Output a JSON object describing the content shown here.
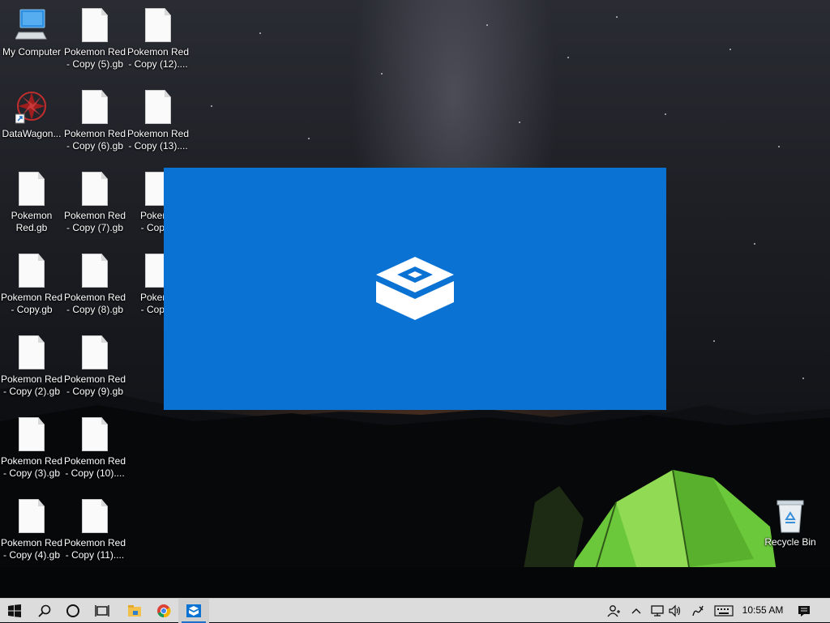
{
  "desktop": {
    "icons": [
      {
        "label": "My Computer"
      },
      {
        "label": "DataWagon..."
      },
      {
        "label": "Pokemon\nRed.gb"
      },
      {
        "label": "Pokemon Red\n- Copy.gb"
      },
      {
        "label": "Pokemon Red\n- Copy (2).gb"
      },
      {
        "label": "Pokemon Red\n- Copy (3).gb"
      },
      {
        "label": "Pokemon Red\n- Copy (4).gb"
      },
      {
        "label": "Pokemon Red\n- Copy (5).gb"
      },
      {
        "label": "Pokemon Red\n- Copy (6).gb"
      },
      {
        "label": "Pokemon Red\n- Copy (7).gb"
      },
      {
        "label": "Pokemon Red\n- Copy (8).gb"
      },
      {
        "label": "Pokemon Red\n- Copy (9).gb"
      },
      {
        "label": "Pokemon Red\n- Copy (10)...."
      },
      {
        "label": "Pokemon Red\n- Copy (11)...."
      },
      {
        "label": "Pokemon Red\n- Copy (12)...."
      },
      {
        "label": "Pokemon Red\n- Copy (13)...."
      },
      {
        "label": "Pokemo\n- Copy ("
      },
      {
        "label": "Pokemo\n- Copy ("
      },
      {
        "label": "Recycle Bin"
      }
    ]
  },
  "splash": {
    "app": "Windows Sandbox",
    "icon": "sandbox-box-icon",
    "background_color": "#0a72d3"
  },
  "taskbar": {
    "start": "windows-logo-icon",
    "search": "search-icon",
    "cortana": "cortana-circle-icon",
    "task_view": "task-view-icon",
    "pinned": [
      "file-explorer-icon",
      "chrome-icon",
      "sandbox-icon"
    ],
    "tray": [
      "people-icon",
      "chevron-up-icon",
      "network-icon",
      "volume-icon",
      "pen-icon",
      "keyboard-icon"
    ],
    "clock": "10:55 AM",
    "notifications": "action-center-icon"
  }
}
